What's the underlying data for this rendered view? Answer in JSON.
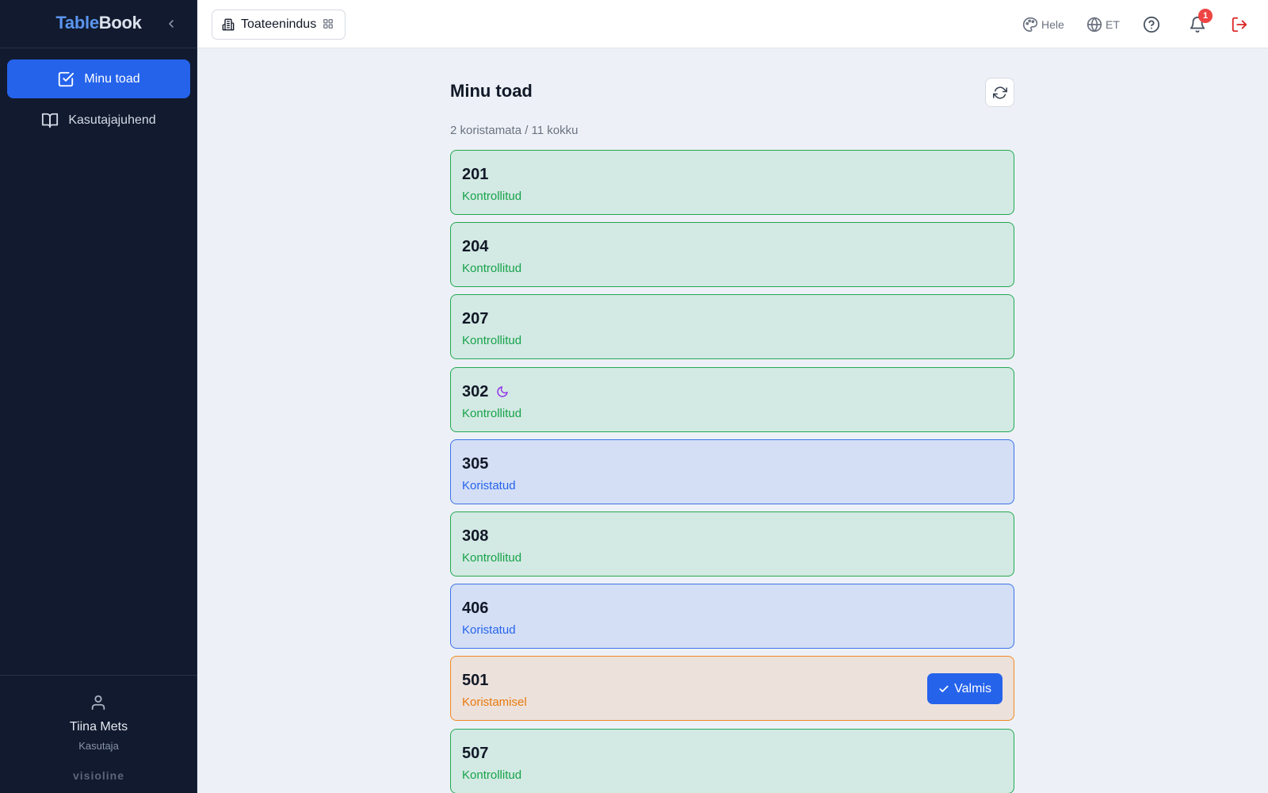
{
  "app": {
    "brand_part1": "Table",
    "brand_part2": "Book"
  },
  "sidebar": {
    "items": [
      {
        "label": "Minu toad",
        "icon": "checkbox-icon",
        "active": true
      },
      {
        "label": "Kasutajajuhend",
        "icon": "book-icon",
        "active": false
      }
    ],
    "user": {
      "name": "Tiina Mets",
      "role": "Kasutaja"
    },
    "vendor": "visioline"
  },
  "topbar": {
    "module_label": "Toateenindus",
    "theme_label": "Hele",
    "language_label": "ET",
    "notification_count": "1"
  },
  "main": {
    "title": "Minu toad",
    "summary": "2 koristamata / 11 kokku",
    "done_label": "Valmis",
    "rooms": [
      {
        "number": "201",
        "status": "Kontrollitud",
        "state": "green"
      },
      {
        "number": "204",
        "status": "Kontrollitud",
        "state": "green"
      },
      {
        "number": "207",
        "status": "Kontrollitud",
        "state": "green"
      },
      {
        "number": "302",
        "status": "Kontrollitud",
        "state": "green",
        "icon": "moon-icon"
      },
      {
        "number": "305",
        "status": "Koristatud",
        "state": "blue"
      },
      {
        "number": "308",
        "status": "Kontrollitud",
        "state": "green"
      },
      {
        "number": "406",
        "status": "Koristatud",
        "state": "blue"
      },
      {
        "number": "501",
        "status": "Koristamisel",
        "state": "orange"
      },
      {
        "number": "507",
        "status": "Kontrollitud",
        "state": "green"
      }
    ]
  },
  "colors": {
    "accent": "#2563eb",
    "sidebar_bg": "#111a2e",
    "status_green": "#16a34a",
    "status_blue": "#2563eb",
    "status_orange": "#ea7a0c",
    "alert": "#ef4444"
  }
}
